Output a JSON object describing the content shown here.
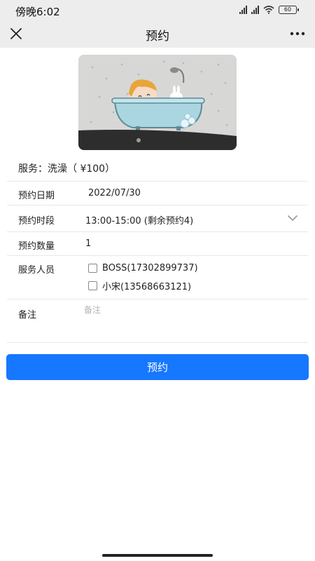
{
  "status_bar": {
    "time": "傍晚6:02",
    "battery": "60",
    "icons": [
      "hd-signal-icon",
      "hd-signal-icon",
      "wifi-icon",
      "battery-icon"
    ]
  },
  "nav": {
    "title": "预约",
    "close_icon": "close-icon",
    "more_icon": "more-icon"
  },
  "hero_image": {
    "subject": "cartoon-girl-in-bathtub"
  },
  "service": {
    "label": "服务：洗澡（ ¥100）"
  },
  "form": {
    "date": {
      "label": "预约日期",
      "value": "2022/07/30"
    },
    "time_slot": {
      "label": "预约时段",
      "value": "13:00-15:00 (剩余预约4)"
    },
    "quantity": {
      "label": "预约数量",
      "value": "1"
    },
    "staff": {
      "label": "服务人员",
      "options": [
        {
          "label": "BOSS(17302899737)",
          "checked": false
        },
        {
          "label": "小宋(13568663121)",
          "checked": false
        }
      ]
    },
    "notes": {
      "label": "备注",
      "placeholder": "备注",
      "value": ""
    }
  },
  "submit": {
    "label": "预约"
  },
  "colors": {
    "accent": "#1677ff",
    "bar_bg": "#ededed"
  }
}
